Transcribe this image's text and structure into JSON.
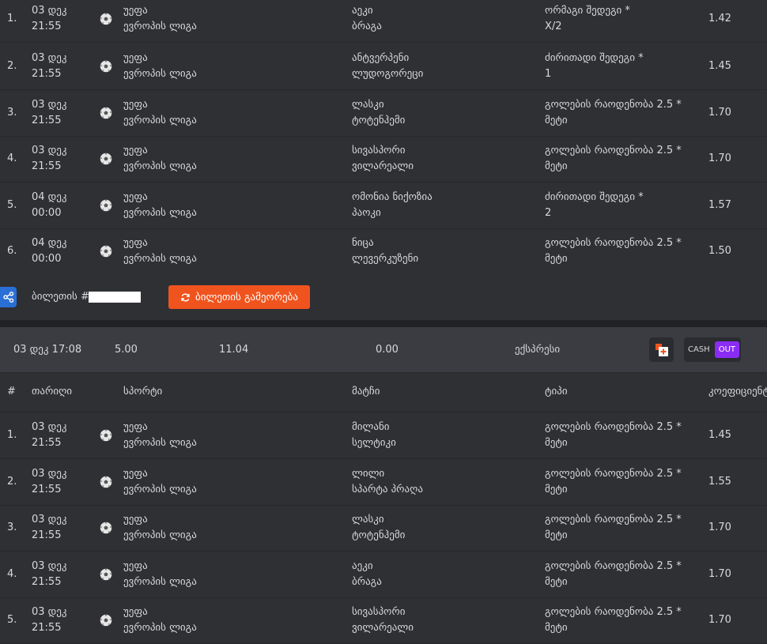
{
  "ticket1": {
    "rows": [
      {
        "num": "1.",
        "date": "03 დეკ",
        "time": "21:55",
        "sport_line1": "უეფა",
        "sport_line2": "ევროპის ლიგა",
        "team1": "აეკი",
        "team2": "ბრაგა",
        "type_line1": "ორმაგი შედეგი *",
        "type_line2": "X/2",
        "odds": "1.42"
      },
      {
        "num": "2.",
        "date": "03 დეკ",
        "time": "21:55",
        "sport_line1": "უეფა",
        "sport_line2": "ევროპის ლიგა",
        "team1": "ანტვერპენი",
        "team2": "ლუდოგორეცი",
        "type_line1": "ძირითადი შედეგი *",
        "type_line2": "1",
        "odds": "1.45"
      },
      {
        "num": "3.",
        "date": "03 დეკ",
        "time": "21:55",
        "sport_line1": "უეფა",
        "sport_line2": "ევროპის ლიგა",
        "team1": "ლასკი",
        "team2": "ტოტენჰემი",
        "type_line1": "გოლების რაოდენობა 2.5 *",
        "type_line2": "მეტი",
        "odds": "1.70"
      },
      {
        "num": "4.",
        "date": "03 დეკ",
        "time": "21:55",
        "sport_line1": "უეფა",
        "sport_line2": "ევროპის ლიგა",
        "team1": "სივასპორი",
        "team2": "ვილარეალი",
        "type_line1": "გოლების რაოდენობა 2.5 *",
        "type_line2": "მეტი",
        "odds": "1.70"
      },
      {
        "num": "5.",
        "date": "04 დეკ",
        "time": "00:00",
        "sport_line1": "უეფა",
        "sport_line2": "ევროპის ლიგა",
        "team1": "ომონია ნიქოზია",
        "team2": "პაოკი",
        "type_line1": "ძირითადი შედეგი *",
        "type_line2": "2",
        "odds": "1.57"
      },
      {
        "num": "6.",
        "date": "04 დეკ",
        "time": "00:00",
        "sport_line1": "უეფა",
        "sport_line2": "ევროპის ლიგა",
        "team1": "ნიცა",
        "team2": "ლევერკუზენი",
        "type_line1": "გოლების რაოდენობა 2.5 *",
        "type_line2": "მეტი",
        "odds": "1.50"
      }
    ],
    "ticket_label": "ბილეთის #",
    "restore_label": "ბილეთის გამეორება"
  },
  "ticket2": {
    "summary": {
      "datetime": "03 დეკ 17:08",
      "stake": "5.00",
      "potential": "11.04",
      "payout": "0.00",
      "bet_type": "ექსპრესი",
      "cash_label": "CASH",
      "out_label": "OUT"
    },
    "headers": {
      "num": "#",
      "date": "თარიღი",
      "sport": "სპორტი",
      "match": "მატჩი",
      "type": "ტიპი",
      "odds": "კოეფიციენტი"
    },
    "rows": [
      {
        "num": "1.",
        "date": "03 დეკ",
        "time": "21:55",
        "sport_line1": "უეფა",
        "sport_line2": "ევროპის ლიგა",
        "team1": "მილანი",
        "team2": "სელტიკი",
        "type_line1": "გოლების რაოდენობა 2.5 *",
        "type_line2": "მეტი",
        "odds": "1.45"
      },
      {
        "num": "2.",
        "date": "03 დეკ",
        "time": "21:55",
        "sport_line1": "უეფა",
        "sport_line2": "ევროპის ლიგა",
        "team1": "ლილი",
        "team2": "სპარტა პრაღა",
        "type_line1": "გოლების რაოდენობა 2.5 *",
        "type_line2": "მეტი",
        "odds": "1.55"
      },
      {
        "num": "3.",
        "date": "03 დეკ",
        "time": "21:55",
        "sport_line1": "უეფა",
        "sport_line2": "ევროპის ლიგა",
        "team1": "ლასკი",
        "team2": "ტოტენჰემი",
        "type_line1": "გოლების რაოდენობა 2.5 *",
        "type_line2": "მეტი",
        "odds": "1.70"
      },
      {
        "num": "4.",
        "date": "03 დეკ",
        "time": "21:55",
        "sport_line1": "უეფა",
        "sport_line2": "ევროპის ლიგა",
        "team1": "აეკი",
        "team2": "ბრაგა",
        "type_line1": "გოლების რაოდენობა 2.5 *",
        "type_line2": "მეტი",
        "odds": "1.70"
      },
      {
        "num": "5.",
        "date": "03 დეკ",
        "time": "21:55",
        "sport_line1": "უეფა",
        "sport_line2": "ევროპის ლიგა",
        "team1": "სივასპორი",
        "team2": "ვილარეალი",
        "type_line1": "გოლების რაოდენობა 2.5 *",
        "type_line2": "მეტი",
        "odds": "1.70"
      }
    ]
  },
  "icons": {
    "sport": "soccer-ball-icon",
    "share": "share-icon",
    "restore": "refresh-icon",
    "add": "add-to-betslip-icon"
  },
  "colors": {
    "background": "#2e3034",
    "summary": "#3a3c41",
    "accent_orange": "#f0541e",
    "share_blue": "#2a6fd6",
    "cashout_purple": "#8b2cf5"
  }
}
